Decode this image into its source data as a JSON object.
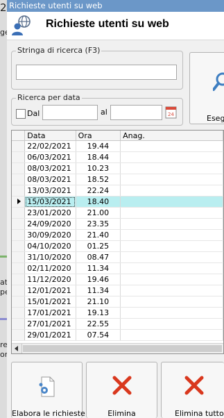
{
  "background_window": {
    "fragments": [
      "2",
      "ge",
      "at",
      "pe",
      "re",
      "ori"
    ]
  },
  "window": {
    "title": "Richieste utenti su web",
    "header_title": "Richieste utenti su web"
  },
  "search": {
    "group_label": "Stringa di ricerca (F3)",
    "value": ""
  },
  "date_search": {
    "group_label": "Ricerca per data",
    "from_label": "Dal",
    "to_label": "al",
    "from_value": "",
    "to_value": "",
    "calendar_day": "24"
  },
  "execute_button": {
    "label": "Esegui"
  },
  "table": {
    "columns": [
      "Data",
      "Ora",
      "Anag."
    ],
    "selected_index": 5,
    "rows": [
      {
        "data": "22/02/2021",
        "ora": "19.44",
        "anag": ""
      },
      {
        "data": "06/03/2021",
        "ora": "18.44",
        "anag": ""
      },
      {
        "data": "08/03/2021",
        "ora": "10.23",
        "anag": ""
      },
      {
        "data": "08/03/2021",
        "ora": "18.52",
        "anag": ""
      },
      {
        "data": "13/03/2021",
        "ora": "22.24",
        "anag": ""
      },
      {
        "data": "15/03/2021",
        "ora": "18.40",
        "anag": ""
      },
      {
        "data": "23/01/2020",
        "ora": "21.00",
        "anag": ""
      },
      {
        "data": "24/09/2020",
        "ora": "23.35",
        "anag": ""
      },
      {
        "data": "30/09/2020",
        "ora": "21.40",
        "anag": ""
      },
      {
        "data": "04/10/2020",
        "ora": "01.25",
        "anag": ""
      },
      {
        "data": "31/10/2020",
        "ora": "08.47",
        "anag": ""
      },
      {
        "data": "02/11/2020",
        "ora": "11.34",
        "anag": ""
      },
      {
        "data": "11/12/2020",
        "ora": "19.46",
        "anag": ""
      },
      {
        "data": "12/01/2021",
        "ora": "11.34",
        "anag": ""
      },
      {
        "data": "15/01/2021",
        "ora": "21.10",
        "anag": ""
      },
      {
        "data": "17/01/2021",
        "ora": "19.13",
        "anag": ""
      },
      {
        "data": "27/01/2021",
        "ora": "22.55",
        "anag": ""
      },
      {
        "data": "29/01/2021",
        "ora": "07.54",
        "anag": ""
      }
    ]
  },
  "buttons": {
    "process": "Elabora le richieste",
    "delete": "Elimina",
    "delete_all": "Elimina tutto"
  },
  "colors": {
    "titlebar": "#6b97c8",
    "selected_row": "#b9eef0",
    "delete_icon": "#d9381e"
  },
  "icons": {
    "header": "user-globe-icon",
    "execute": "magnifier-icon",
    "calendar": "calendar-icon",
    "process": "document-gear-icon",
    "delete": "red-x-icon",
    "delete_all": "red-x-icon"
  }
}
